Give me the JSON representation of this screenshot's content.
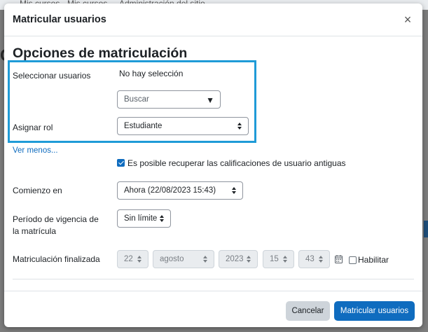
{
  "background": {
    "nav_items": [
      "Mis cursos",
      "Mis cursos",
      "Administración del sitio"
    ],
    "page_char": "C"
  },
  "modal": {
    "title": "Matricular usuarios",
    "close_symbol": "×",
    "section_title": "Opciones de matriculación",
    "select_users": {
      "label": "Seleccionar usuarios",
      "selection": "No hay selección",
      "search_placeholder": "Buscar"
    },
    "assign_role": {
      "label": "Asignar rol",
      "value": "Estudiante"
    },
    "show_less": "Ver menos...",
    "recover_grades": {
      "label": "Es posible recuperar las calificaciones de usuario antiguas",
      "checked": true
    },
    "start": {
      "label": "Comienzo en",
      "value": "Ahora (22/08/2023 15:43)"
    },
    "duration": {
      "label": "Período de vigencia de la matrícula",
      "value": "Sin límite"
    },
    "end": {
      "label": "Matriculación finalizada",
      "day": "22",
      "month": "agosto",
      "year": "2023",
      "hour": "15",
      "minute": "43",
      "enable_label": "Habilitar",
      "enabled": false
    },
    "buttons": {
      "cancel": "Cancelar",
      "submit": "Matricular usuarios"
    }
  },
  "colors": {
    "primary": "#0f6cbf",
    "highlight": "#1f9bd7",
    "cancel_bg": "#ced4da",
    "overlay": "#7d7d7d"
  }
}
